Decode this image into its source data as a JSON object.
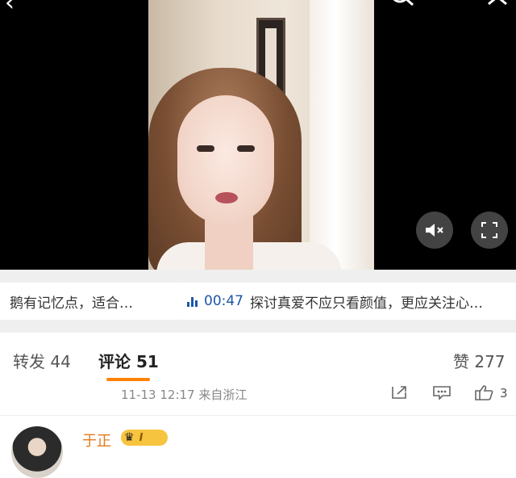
{
  "video": {
    "back_icon": "chevron-left-icon",
    "search_icon": "search-icon",
    "close_icon": "close-icon",
    "mute_icon": "mute-icon",
    "fullscreen_icon": "fullscreen-icon"
  },
  "chapters": [
    {
      "text": "鹅有记忆点，适合…"
    },
    {
      "time": "00:47",
      "text": "探讨真爱不应只看颜值，更应关注心…"
    }
  ],
  "tabs": {
    "repost": "转发 44",
    "comment_label": "评论",
    "comment_count": "51",
    "like": "赞 277"
  },
  "comment_meta": {
    "time_location": "11-13 12:17  来自浙江",
    "like_count": "3"
  },
  "comment": {
    "username": "于正",
    "badge_level": "I"
  },
  "colors": {
    "accent_orange": "#ff8200",
    "link_blue": "#1c56a8",
    "username_color": "#e57a1e"
  }
}
